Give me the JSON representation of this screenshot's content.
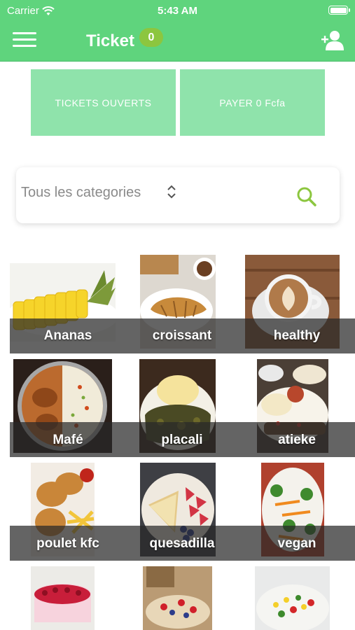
{
  "status": {
    "carrier": "Carrier",
    "time": "5:43 AM"
  },
  "header": {
    "title": "Ticket",
    "badge_count": "0"
  },
  "actions": {
    "open_tickets": "TICKETS OUVERTS",
    "pay": "PAYER  0 Fcfa"
  },
  "filter": {
    "category": "Tous les categories"
  },
  "categories": [
    {
      "label": "Ananas"
    },
    {
      "label": "croissant"
    },
    {
      "label": "healthy"
    },
    {
      "label": "Mafé"
    },
    {
      "label": "placali"
    },
    {
      "label": "atieke"
    },
    {
      "label": "poulet kfc"
    },
    {
      "label": "quesadilla"
    },
    {
      "label": "vegan"
    }
  ],
  "colors": {
    "header": "#5fd47d",
    "badge": "#8cc63f",
    "action_tiles": "#8fe3ab",
    "search_icon": "#8cc63f"
  }
}
